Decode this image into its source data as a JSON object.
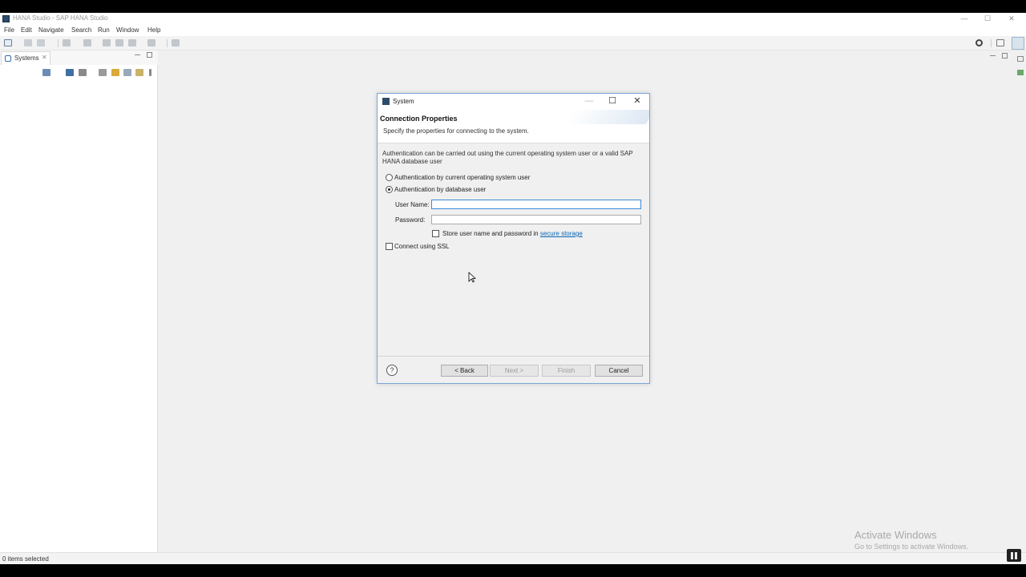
{
  "window": {
    "title": "HANA Studio - SAP HANA Studio"
  },
  "menu": [
    "File",
    "Edit",
    "Navigate",
    "Search",
    "Run",
    "Window",
    "Help"
  ],
  "left_view": {
    "tab_label": "Systems",
    "close_symbol": "✕"
  },
  "status": {
    "text": "0 items selected"
  },
  "watermark": {
    "line1": "Activate Windows",
    "line2": "Go to Settings to activate Windows."
  },
  "dialog": {
    "title": "System",
    "heading": "Connection Properties",
    "description": "Specify the properties for connecting to the system.",
    "auth_description": "Authentication can be carried out using the current operating system user or a valid SAP HANA database user",
    "radio_os_user": "Authentication by current operating system user",
    "radio_db_user": "Authentication by database user",
    "selected_auth": "db_user",
    "user_name_label": "User Name:",
    "user_name_value": "",
    "password_label": "Password:",
    "password_value": "",
    "store_checkbox_text": "Store user name and password in ",
    "store_link": "secure storage",
    "store_checked": false,
    "ssl_label": "Connect using SSL",
    "ssl_checked": false,
    "help_symbol": "?",
    "buttons": {
      "back": "< Back",
      "next": "Next >",
      "finish": "Finish",
      "cancel": "Cancel"
    }
  },
  "icons": {
    "minimize": "—",
    "maximize": "☐",
    "close": "✕"
  }
}
